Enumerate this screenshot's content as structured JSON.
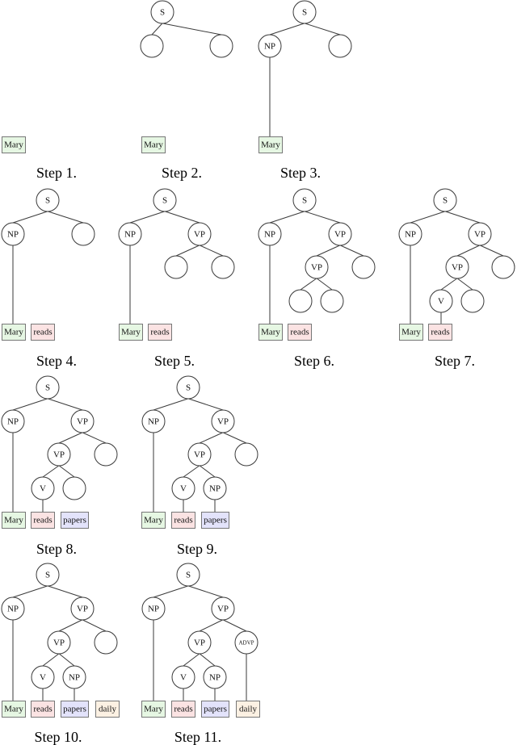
{
  "figure": {
    "description": "Incremental construction of a parse tree for the sentence 'Mary reads papers daily'",
    "word_colors": {
      "Mary": "#e6f7e3",
      "reads": "#fbe3e3",
      "papers": "#e3e3fb",
      "daily": "#fcf1e3"
    },
    "steps": [
      {
        "label": "Step 1.",
        "words": [
          "Mary"
        ],
        "nodes": [],
        "edges": [],
        "word_links": []
      },
      {
        "label": "Step 2.",
        "words": [
          "Mary"
        ],
        "nodes": [
          {
            "id": "s",
            "label": "S"
          },
          {
            "id": "a",
            "label": ""
          },
          {
            "id": "b",
            "label": ""
          }
        ],
        "edges": [
          [
            "s",
            "a"
          ],
          [
            "s",
            "b"
          ]
        ],
        "word_links": []
      },
      {
        "label": "Step 3.",
        "words": [
          "Mary"
        ],
        "nodes": [
          {
            "id": "s",
            "label": "S"
          },
          {
            "id": "np",
            "label": "NP"
          },
          {
            "id": "b",
            "label": ""
          }
        ],
        "edges": [
          [
            "s",
            "np"
          ],
          [
            "s",
            "b"
          ]
        ],
        "word_links": [
          [
            "np",
            "Mary"
          ]
        ]
      },
      {
        "label": "Step 4.",
        "words": [
          "Mary",
          "reads"
        ],
        "nodes": [
          {
            "id": "s",
            "label": "S"
          },
          {
            "id": "np",
            "label": "NP"
          },
          {
            "id": "b",
            "label": ""
          }
        ],
        "edges": [
          [
            "s",
            "np"
          ],
          [
            "s",
            "b"
          ]
        ],
        "word_links": [
          [
            "np",
            "Mary"
          ]
        ]
      },
      {
        "label": "Step 5.",
        "words": [
          "Mary",
          "reads"
        ],
        "nodes": [
          {
            "id": "s",
            "label": "S"
          },
          {
            "id": "np",
            "label": "NP"
          },
          {
            "id": "vp",
            "label": "VP"
          },
          {
            "id": "c",
            "label": ""
          },
          {
            "id": "d",
            "label": ""
          }
        ],
        "edges": [
          [
            "s",
            "np"
          ],
          [
            "s",
            "vp"
          ],
          [
            "vp",
            "c"
          ],
          [
            "vp",
            "d"
          ]
        ],
        "word_links": [
          [
            "np",
            "Mary"
          ]
        ]
      },
      {
        "label": "Step 6.",
        "words": [
          "Mary",
          "reads"
        ],
        "nodes": [
          {
            "id": "s",
            "label": "S"
          },
          {
            "id": "np",
            "label": "NP"
          },
          {
            "id": "vp",
            "label": "VP"
          },
          {
            "id": "vp2",
            "label": "VP"
          },
          {
            "id": "d",
            "label": ""
          },
          {
            "id": "e",
            "label": ""
          },
          {
            "id": "f",
            "label": ""
          }
        ],
        "edges": [
          [
            "s",
            "np"
          ],
          [
            "s",
            "vp"
          ],
          [
            "vp",
            "vp2"
          ],
          [
            "vp",
            "d"
          ],
          [
            "vp2",
            "e"
          ],
          [
            "vp2",
            "f"
          ]
        ],
        "word_links": [
          [
            "np",
            "Mary"
          ]
        ]
      },
      {
        "label": "Step 7.",
        "words": [
          "Mary",
          "reads"
        ],
        "nodes": [
          {
            "id": "s",
            "label": "S"
          },
          {
            "id": "np",
            "label": "NP"
          },
          {
            "id": "vp",
            "label": "VP"
          },
          {
            "id": "vp2",
            "label": "VP"
          },
          {
            "id": "d",
            "label": ""
          },
          {
            "id": "v",
            "label": "V"
          },
          {
            "id": "f",
            "label": ""
          }
        ],
        "edges": [
          [
            "s",
            "np"
          ],
          [
            "s",
            "vp"
          ],
          [
            "vp",
            "vp2"
          ],
          [
            "vp",
            "d"
          ],
          [
            "vp2",
            "v"
          ],
          [
            "vp2",
            "f"
          ]
        ],
        "word_links": [
          [
            "np",
            "Mary"
          ],
          [
            "v",
            "reads"
          ]
        ]
      },
      {
        "label": "Step 8.",
        "words": [
          "Mary",
          "reads",
          "papers"
        ],
        "nodes": [
          {
            "id": "s",
            "label": "S"
          },
          {
            "id": "np",
            "label": "NP"
          },
          {
            "id": "vp",
            "label": "VP"
          },
          {
            "id": "vp2",
            "label": "VP"
          },
          {
            "id": "d",
            "label": ""
          },
          {
            "id": "v",
            "label": "V"
          },
          {
            "id": "f",
            "label": ""
          }
        ],
        "edges": [
          [
            "s",
            "np"
          ],
          [
            "s",
            "vp"
          ],
          [
            "vp",
            "vp2"
          ],
          [
            "vp",
            "d"
          ],
          [
            "vp2",
            "v"
          ],
          [
            "vp2",
            "f"
          ]
        ],
        "word_links": [
          [
            "np",
            "Mary"
          ],
          [
            "v",
            "reads"
          ]
        ]
      },
      {
        "label": "Step 9.",
        "words": [
          "Mary",
          "reads",
          "papers"
        ],
        "nodes": [
          {
            "id": "s",
            "label": "S"
          },
          {
            "id": "np",
            "label": "NP"
          },
          {
            "id": "vp",
            "label": "VP"
          },
          {
            "id": "vp2",
            "label": "VP"
          },
          {
            "id": "d",
            "label": ""
          },
          {
            "id": "v",
            "label": "V"
          },
          {
            "id": "np2",
            "label": "NP"
          }
        ],
        "edges": [
          [
            "s",
            "np"
          ],
          [
            "s",
            "vp"
          ],
          [
            "vp",
            "vp2"
          ],
          [
            "vp",
            "d"
          ],
          [
            "vp2",
            "v"
          ],
          [
            "vp2",
            "np2"
          ]
        ],
        "word_links": [
          [
            "np",
            "Mary"
          ],
          [
            "v",
            "reads"
          ],
          [
            "np2",
            "papers"
          ]
        ]
      },
      {
        "label": "Step 10.",
        "words": [
          "Mary",
          "reads",
          "papers",
          "daily"
        ],
        "nodes": [
          {
            "id": "s",
            "label": "S"
          },
          {
            "id": "np",
            "label": "NP"
          },
          {
            "id": "vp",
            "label": "VP"
          },
          {
            "id": "vp2",
            "label": "VP"
          },
          {
            "id": "d",
            "label": ""
          },
          {
            "id": "v",
            "label": "V"
          },
          {
            "id": "np2",
            "label": "NP"
          }
        ],
        "edges": [
          [
            "s",
            "np"
          ],
          [
            "s",
            "vp"
          ],
          [
            "vp",
            "vp2"
          ],
          [
            "vp",
            "d"
          ],
          [
            "vp2",
            "v"
          ],
          [
            "vp2",
            "np2"
          ]
        ],
        "word_links": [
          [
            "np",
            "Mary"
          ],
          [
            "v",
            "reads"
          ],
          [
            "np2",
            "papers"
          ]
        ]
      },
      {
        "label": "Step 11.",
        "words": [
          "Mary",
          "reads",
          "papers",
          "daily"
        ],
        "nodes": [
          {
            "id": "s",
            "label": "S"
          },
          {
            "id": "np",
            "label": "NP"
          },
          {
            "id": "vp",
            "label": "VP"
          },
          {
            "id": "vp2",
            "label": "VP"
          },
          {
            "id": "advp",
            "label": "ADVP"
          },
          {
            "id": "v",
            "label": "V"
          },
          {
            "id": "np2",
            "label": "NP"
          }
        ],
        "edges": [
          [
            "s",
            "np"
          ],
          [
            "s",
            "vp"
          ],
          [
            "vp",
            "vp2"
          ],
          [
            "vp",
            "advp"
          ],
          [
            "vp2",
            "v"
          ],
          [
            "vp2",
            "np2"
          ]
        ],
        "word_links": [
          [
            "np",
            "Mary"
          ],
          [
            "v",
            "reads"
          ],
          [
            "np2",
            "papers"
          ],
          [
            "advp",
            "daily"
          ]
        ]
      }
    ]
  }
}
